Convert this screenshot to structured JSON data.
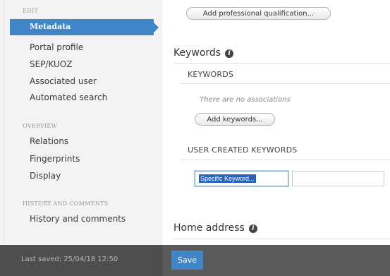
{
  "sidebar": {
    "sections": [
      {
        "heading": "EDIT",
        "items": [
          "Metadata",
          "Portal profile",
          "SEP/KUOZ",
          "Associated user",
          "Automated search"
        ]
      },
      {
        "heading": "OVERVIEW",
        "items": [
          "Relations",
          "Fingerprints",
          "Display"
        ]
      },
      {
        "heading": "HISTORY AND COMMENTS",
        "items": [
          "History and comments"
        ]
      }
    ],
    "active_item": "Metadata",
    "last_saved": "Last saved: 25/04/18 12:50"
  },
  "main": {
    "add_qualification_button": "Add professional qualification...",
    "keywords_title": "Keywords",
    "keywords_subheading": "KEYWORDS",
    "no_associations": "There are no associations",
    "add_keywords_button": "Add keywords...",
    "user_keywords_subheading": "USER CREATED KEYWORDS",
    "keyword_input_value": "Specific Keyword...",
    "home_address_title": "Home address",
    "save_button": "Save"
  },
  "colors": {
    "accent": "#3f85c7",
    "footer": "#4e4e4e",
    "sidebar_bg": "#f3f3f3"
  }
}
